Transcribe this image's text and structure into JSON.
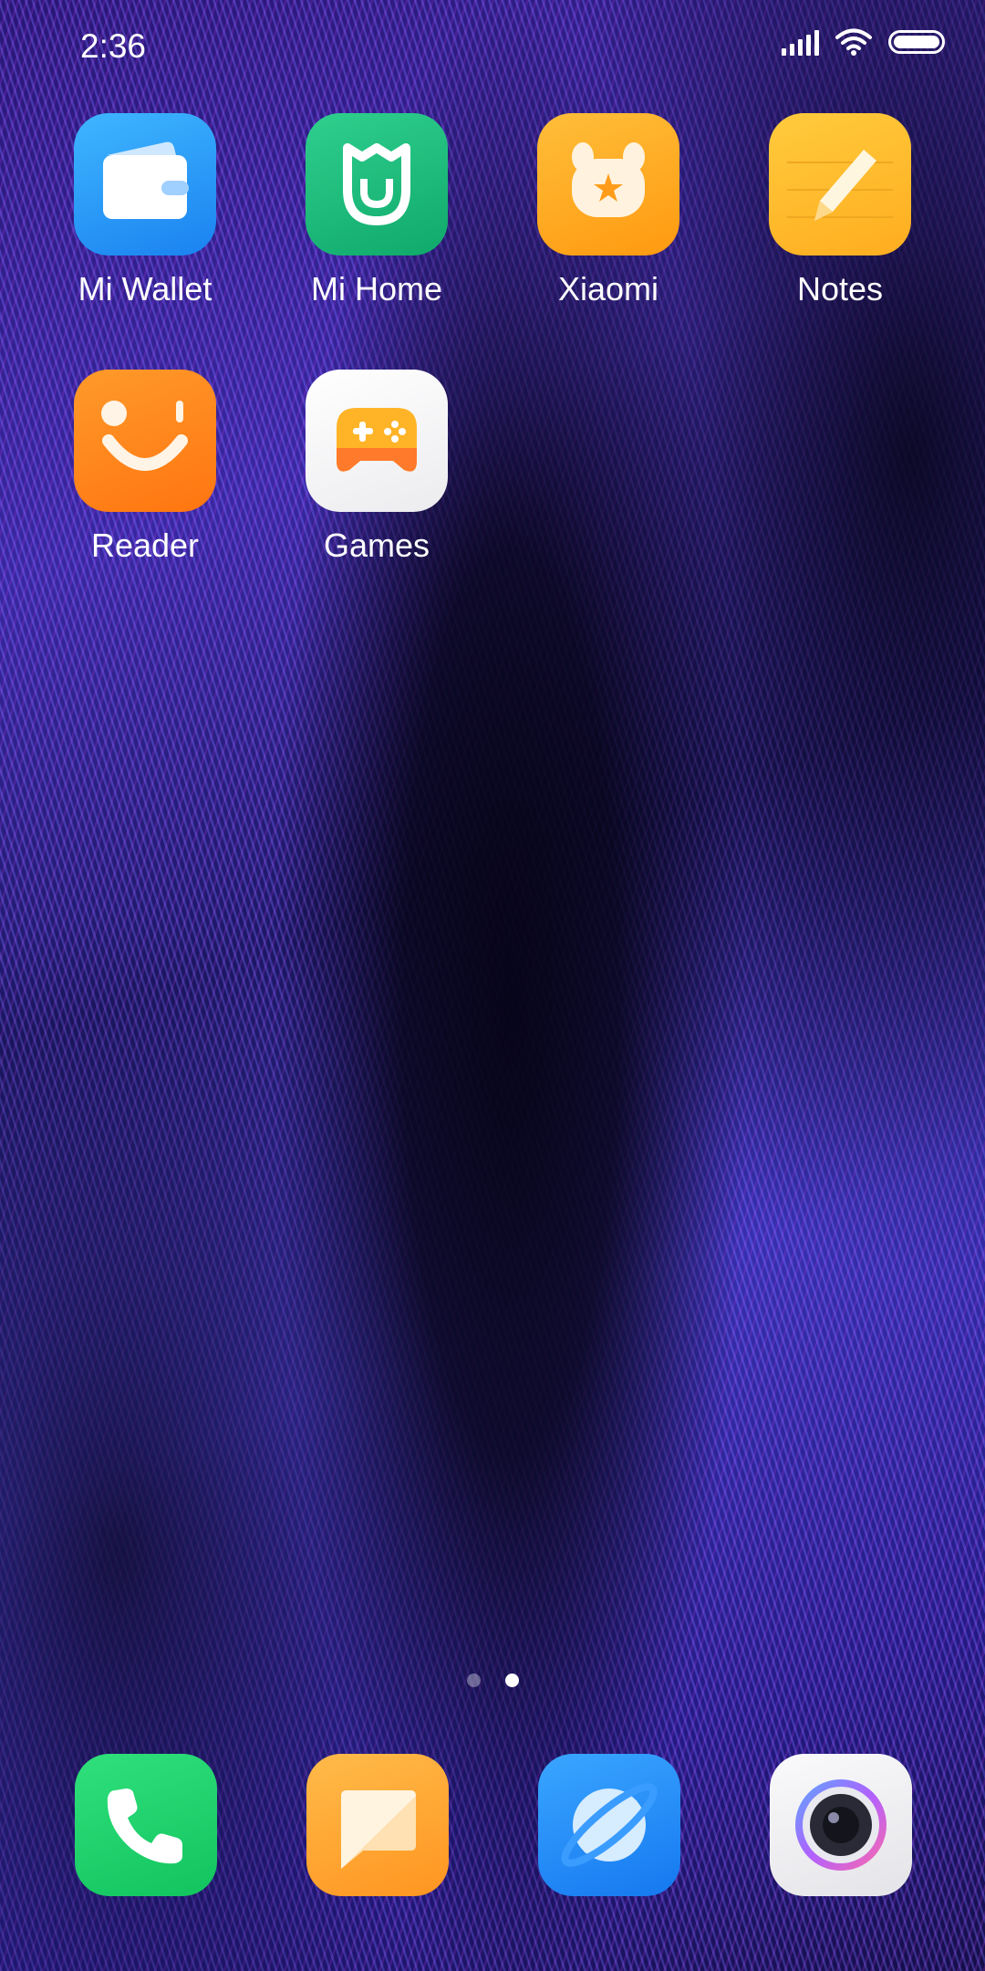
{
  "status_bar": {
    "time": "2:36",
    "icons": [
      "signal-icon",
      "wifi-icon",
      "battery-icon"
    ]
  },
  "apps": [
    {
      "label": "Mi  Wallet",
      "icon": "wallet-icon",
      "color": "#2196f3"
    },
    {
      "label": "Mi  Home",
      "icon": "mi-home-icon",
      "color": "#1fb87a"
    },
    {
      "label": "Xiaomi",
      "icon": "mi-bunny-icon",
      "color": "#ffa81e"
    },
    {
      "label": "Notes",
      "icon": "notes-pencil-icon",
      "color": "#ffbb2c"
    },
    {
      "label": "Reader",
      "icon": "reader-smile-icon",
      "color": "#ff8419"
    },
    {
      "label": "Games",
      "icon": "gamepad-icon",
      "color": "#ffffff"
    }
  ],
  "page_indicator": {
    "pages": 2,
    "current": 2
  },
  "dock": [
    {
      "name": "phone",
      "icon": "phone-icon",
      "color": "#1ed36a"
    },
    {
      "name": "messages",
      "icon": "message-icon",
      "color": "#ffa83a"
    },
    {
      "name": "browser",
      "icon": "browser-planet-icon",
      "color": "#1e8cff"
    },
    {
      "name": "camera",
      "icon": "camera-icon",
      "color": "#f2f2f4"
    }
  ]
}
